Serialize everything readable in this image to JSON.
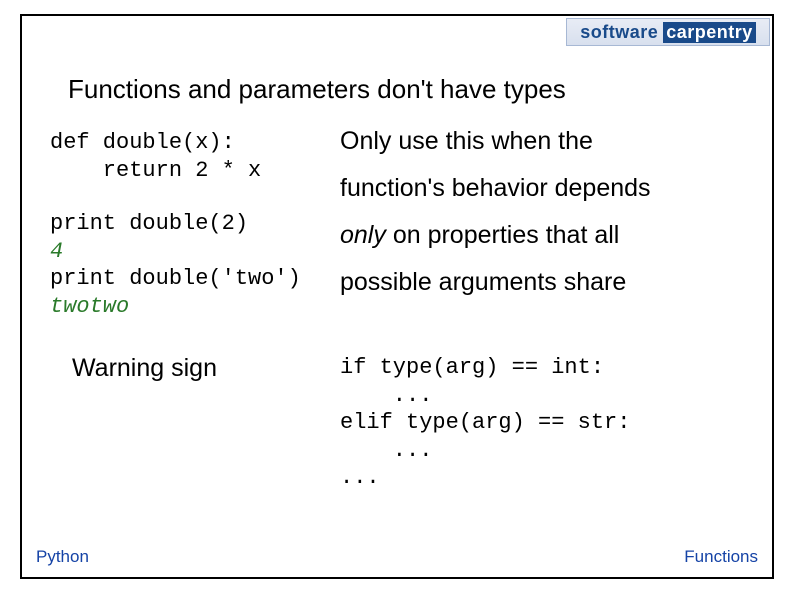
{
  "logo": {
    "left": "software",
    "right": "carpentry"
  },
  "heading": "Functions and parameters don't have types",
  "code1": {
    "l1": "def double(x):",
    "l2": "    return 2 * x"
  },
  "code2": {
    "l1": "print double(2)",
    "o1": "4",
    "l2": "print double('two')",
    "o2": "twotwo"
  },
  "paras": {
    "p1": "Only use this when the",
    "p2": "function's behavior depends",
    "p3_only": "only",
    "p3_rest": " on properties that all",
    "p4": "possible arguments share"
  },
  "warning": "Warning sign",
  "code3": {
    "l1": "if type(arg) == int:",
    "l2": "    ...",
    "l3": "elif type(arg) == str:",
    "l4": "    ...",
    "l5": "..."
  },
  "footer": {
    "left": "Python",
    "right": "Functions"
  }
}
